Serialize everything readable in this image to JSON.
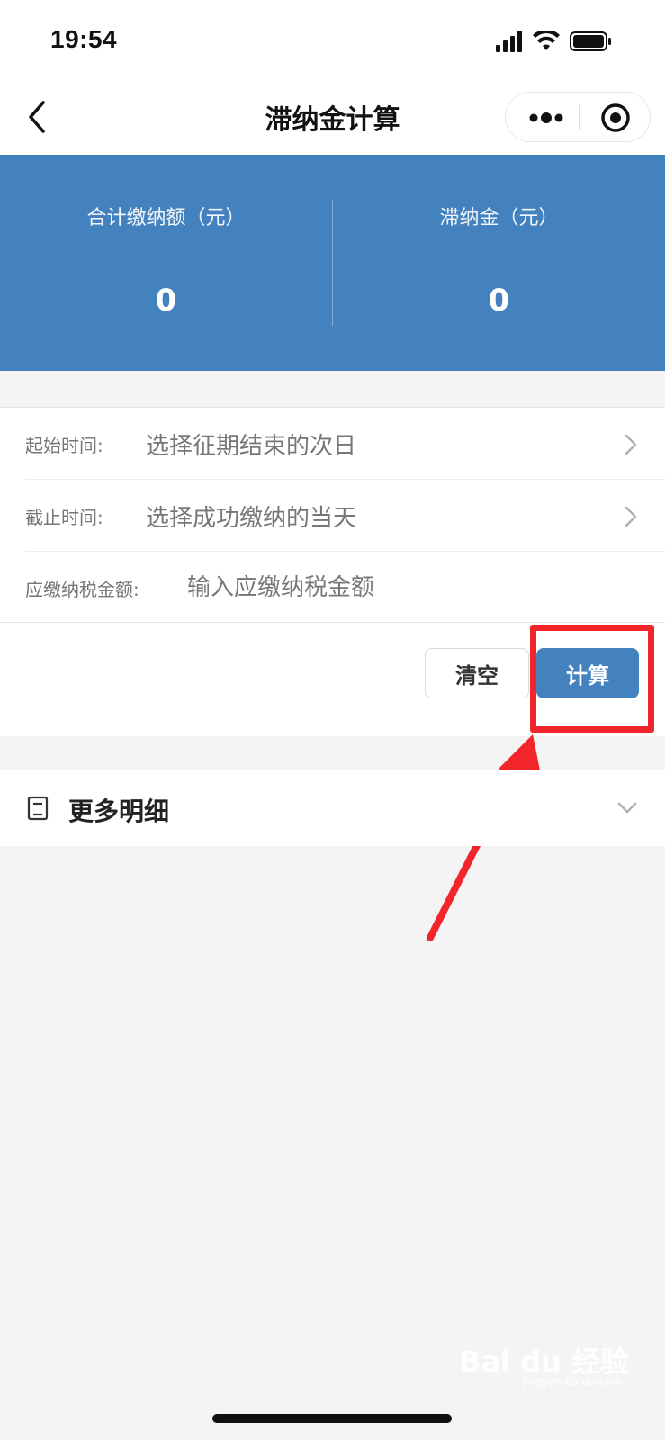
{
  "status_bar": {
    "time": "19:54",
    "icons": [
      "signal-icon",
      "wifi-icon",
      "battery-icon"
    ]
  },
  "nav": {
    "title": "滞纳金计算",
    "back_icon": "back-arrow-icon",
    "more_icon": "more-dots-icon",
    "close_icon": "target-close-icon"
  },
  "summary": {
    "total_label": "合计缴纳额（元）",
    "total_value": "0",
    "late_fee_label": "滞纳金（元）",
    "late_fee_value": "0"
  },
  "form": {
    "start_label": "起始时间:",
    "start_value": "选择征期结束的次日",
    "end_label": "截止时间:",
    "end_value": "选择成功缴纳的当天",
    "amount_label": "应缴纳税金额:",
    "amount_value": "",
    "amount_placeholder": "输入应缴纳税金额"
  },
  "actions": {
    "clear_label": "清空",
    "calculate_label": "计算"
  },
  "details": {
    "label": "更多明细"
  },
  "watermark": {
    "text": "Bai du 经验",
    "sub": "jingyan.baidu.com"
  },
  "colors": {
    "primary": "#4382bf",
    "annotation": "#f2252a",
    "background": "#f4f4f4"
  }
}
